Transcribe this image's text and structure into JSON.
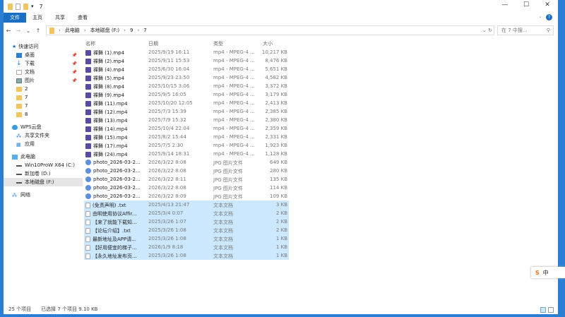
{
  "window": {
    "title": "7",
    "min": "—",
    "max": "☐",
    "close": "✕"
  },
  "ribbon": {
    "tabs": [
      "文件",
      "主页",
      "共享",
      "查看"
    ],
    "help": "?"
  },
  "address": {
    "path": [
      "此电脑",
      "本地磁盘 (F:)",
      "9",
      "7"
    ],
    "search_placeholder": "在 7 中搜..."
  },
  "nav": {
    "quick_access": "快速访问",
    "pinned": [
      "桌面",
      "下载",
      "文档",
      "图片"
    ],
    "folders": [
      "2",
      "7",
      "7",
      "8"
    ],
    "wps": "WPS云盘",
    "shared": "共享文件夹",
    "apps": "应用",
    "this_pc": "此电脑",
    "drives": [
      "Win10ProW X64 (C:)",
      "新加卷 (D:)",
      "本地磁盘 (F:)"
    ],
    "network": "网络"
  },
  "columns": [
    "名称",
    "日期",
    "类型",
    "大小"
  ],
  "files": [
    {
      "name": "裸舞 (1).mp4",
      "date": "2025/9/19 16:11",
      "type": "mp4 - MPEG-4 ...",
      "size": "10,217 KB",
      "kind": "video",
      "sel": false
    },
    {
      "name": "裸舞 (2).mp4",
      "date": "2025/9/11 15:53",
      "type": "mp4 - MPEG-4 ...",
      "size": "8,476 KB",
      "kind": "video",
      "sel": false
    },
    {
      "name": "裸舞 (4).mp4",
      "date": "2025/6/30 16:04",
      "type": "mp4 - MPEG-4 ...",
      "size": "5,651 KB",
      "kind": "video",
      "sel": false
    },
    {
      "name": "裸舞 (5).mp4",
      "date": "2025/9/23 23:50",
      "type": "mp4 - MPEG-4 ...",
      "size": "4,582 KB",
      "kind": "video",
      "sel": false
    },
    {
      "name": "裸舞 (8).mp4",
      "date": "2025/10/15 3:06",
      "type": "mp4 - MPEG-4 ...",
      "size": "3,372 KB",
      "kind": "video",
      "sel": false
    },
    {
      "name": "裸舞 (9).mp4",
      "date": "2025/9/5 16:05",
      "type": "mp4 - MPEG-4 ...",
      "size": "3,179 KB",
      "kind": "video",
      "sel": false
    },
    {
      "name": "裸舞 (11).mp4",
      "date": "2025/10/20 12:05",
      "type": "mp4 - MPEG-4 ...",
      "size": "2,413 KB",
      "kind": "video",
      "sel": false
    },
    {
      "name": "裸舞 (12).mp4",
      "date": "2025/7/3 15:39",
      "type": "mp4 - MPEG-4 ...",
      "size": "2,385 KB",
      "kind": "video",
      "sel": false
    },
    {
      "name": "裸舞 (13).mp4",
      "date": "2025/7/9 15:32",
      "type": "mp4 - MPEG-4 ...",
      "size": "2,380 KB",
      "kind": "video",
      "sel": false
    },
    {
      "name": "裸舞 (14).mp4",
      "date": "2025/10/4 22:04",
      "type": "mp4 - MPEG-4 ...",
      "size": "2,359 KB",
      "kind": "video",
      "sel": false
    },
    {
      "name": "裸舞 (15).mp4",
      "date": "2025/8/2 15:44",
      "type": "mp4 - MPEG-4 ...",
      "size": "2,331 KB",
      "kind": "video",
      "sel": false
    },
    {
      "name": "裸舞 (17).mp4",
      "date": "2025/7/5 2:30",
      "type": "mp4 - MPEG-4 ...",
      "size": "1,923 KB",
      "kind": "video",
      "sel": false
    },
    {
      "name": "裸舞 (24).mp4",
      "date": "2025/9/14 18:31",
      "type": "mp4 - MPEG-4 ...",
      "size": "1,128 KB",
      "kind": "video",
      "sel": false
    },
    {
      "name": "photo_2026-03-2...",
      "date": "2026/3/22 8:08",
      "type": "JPG 图片文件",
      "size": "649 KB",
      "kind": "image",
      "sel": false
    },
    {
      "name": "photo_2026-03-2...",
      "date": "2026/3/22 8:08",
      "type": "JPG 图片文件",
      "size": "280 KB",
      "kind": "image",
      "sel": false
    },
    {
      "name": "photo_2026-03-2...",
      "date": "2026/3/22 8:11",
      "type": "JPG 图片文件",
      "size": "135 KB",
      "kind": "image",
      "sel": false
    },
    {
      "name": "photo_2026-03-2...",
      "date": "2026/3/22 8:08",
      "type": "JPG 图片文件",
      "size": "114 KB",
      "kind": "image",
      "sel": false
    },
    {
      "name": "photo_2026-03-2...",
      "date": "2026/3/22 8:09",
      "type": "JPG 图片文件",
      "size": "109 KB",
      "kind": "image",
      "sel": false
    },
    {
      "name": "(免责声明) .txt",
      "date": "2025/4/13 21:47",
      "type": "文本文档",
      "size": "3 KB",
      "kind": "text",
      "sel": true
    },
    {
      "name": "由明使用协议Affir...",
      "date": "2025/3/4 0:07",
      "type": "文本文档",
      "size": "2 KB",
      "kind": "text",
      "sel": true
    },
    {
      "name": "【来了就能下载知...",
      "date": "2025/3/26 1:07",
      "type": "文本文档",
      "size": "2 KB",
      "kind": "text",
      "sel": true
    },
    {
      "name": "【论坛介绍】.txt",
      "date": "2025/3/26 1:08",
      "type": "文本文档",
      "size": "2 KB",
      "kind": "text",
      "sel": true
    },
    {
      "name": "最新地址及APP请...",
      "date": "2025/3/26 1:08",
      "type": "文本文档",
      "size": "1 KB",
      "kind": "text",
      "sel": true
    },
    {
      "name": "【好用便宜的梯子...",
      "date": "2026/1/9 8:18",
      "type": "文本文档",
      "size": "1 KB",
      "kind": "text",
      "sel": true
    },
    {
      "name": "【永久地址发布页...",
      "date": "2025/3/26 1:08",
      "type": "文本文档",
      "size": "1 KB",
      "kind": "text",
      "sel": true
    }
  ],
  "status": {
    "count": "25 个项目",
    "selected": "已选择 7 个项目  9.10 KB"
  },
  "ime": {
    "logo": "S",
    "mode": "中"
  }
}
